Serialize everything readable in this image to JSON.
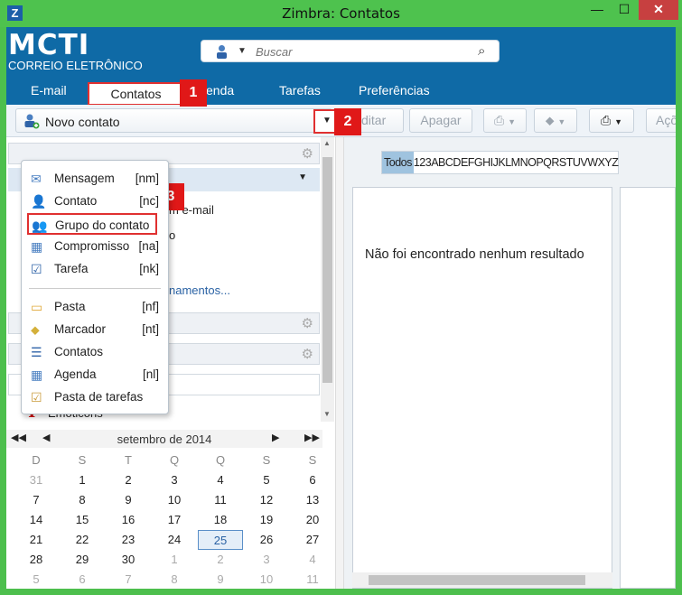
{
  "window": {
    "title": "Zimbra: Contatos",
    "app_icon": "Z",
    "minimize": "—",
    "maximize": "☐",
    "close": "✕"
  },
  "brand": {
    "name": "MCTI",
    "subtitle": "CORREIO ELETRÔNICO",
    "color": "#0f6aa6"
  },
  "search": {
    "placeholder": "Buscar"
  },
  "tabs": {
    "email": "E-mail",
    "contacts": "Contatos",
    "agenda_partial": "enda",
    "tasks": "Tarefas",
    "preferences": "Preferências"
  },
  "toolbar": {
    "new_contact": "Novo contato",
    "edit_partial": "ditar",
    "delete": "Apagar",
    "actions_partial": "Açõ"
  },
  "badges": [
    "1",
    "2",
    "3"
  ],
  "menu": {
    "items_top": [
      {
        "label": "Mensagem",
        "key": "[nm]",
        "icon": "envelope-icon"
      },
      {
        "label": "Contato",
        "key": "[nc]",
        "icon": "contact-icon"
      },
      {
        "label": "Grupo do contato",
        "key": "",
        "icon": "contact-group-icon"
      },
      {
        "label": "Compromisso",
        "key": "[na]",
        "icon": "appointment-icon"
      },
      {
        "label": "Tarefa",
        "key": "[nk]",
        "icon": "task-icon"
      }
    ],
    "items_bottom": [
      {
        "label": "Pasta",
        "key": "[nf]",
        "icon": "folder-icon"
      },
      {
        "label": "Marcador",
        "key": "[nt]",
        "icon": "tag-icon"
      },
      {
        "label": "Contatos",
        "key": "",
        "icon": "address-book-icon"
      },
      {
        "label": "Agenda",
        "key": "[nl]",
        "icon": "calendar-icon"
      },
      {
        "label": "Pasta de tarefas",
        "key": "",
        "icon": "task-folder-icon"
      }
    ]
  },
  "left": {
    "partial_email": "m e-mail",
    "partial_o": "o",
    "partial_sharing": "namentos...",
    "emoticons": "Emoticons"
  },
  "calendar": {
    "month": "setembro de 2014",
    "prev_year": "◀◀",
    "prev_month": "◀",
    "next_month": "▶",
    "next_year": "▶▶",
    "dow": [
      "D",
      "S",
      "T",
      "Q",
      "Q",
      "S",
      "S"
    ],
    "weeks": [
      [
        "31",
        "1",
        "2",
        "3",
        "4",
        "5",
        "6"
      ],
      [
        "7",
        "8",
        "9",
        "10",
        "11",
        "12",
        "13"
      ],
      [
        "14",
        "15",
        "16",
        "17",
        "18",
        "19",
        "20"
      ],
      [
        "21",
        "22",
        "23",
        "24",
        "25",
        "26",
        "27"
      ],
      [
        "28",
        "29",
        "30",
        "1",
        "2",
        "3",
        "4"
      ],
      [
        "5",
        "6",
        "7",
        "8",
        "9",
        "10",
        "11"
      ]
    ],
    "today": "25"
  },
  "alphabet": {
    "selected": "Todos",
    "rest": "123ABCDEFGHIJKLMNOPQRSTUVWXYZ"
  },
  "results": {
    "empty": "Não foi encontrado nenhum resultado"
  }
}
